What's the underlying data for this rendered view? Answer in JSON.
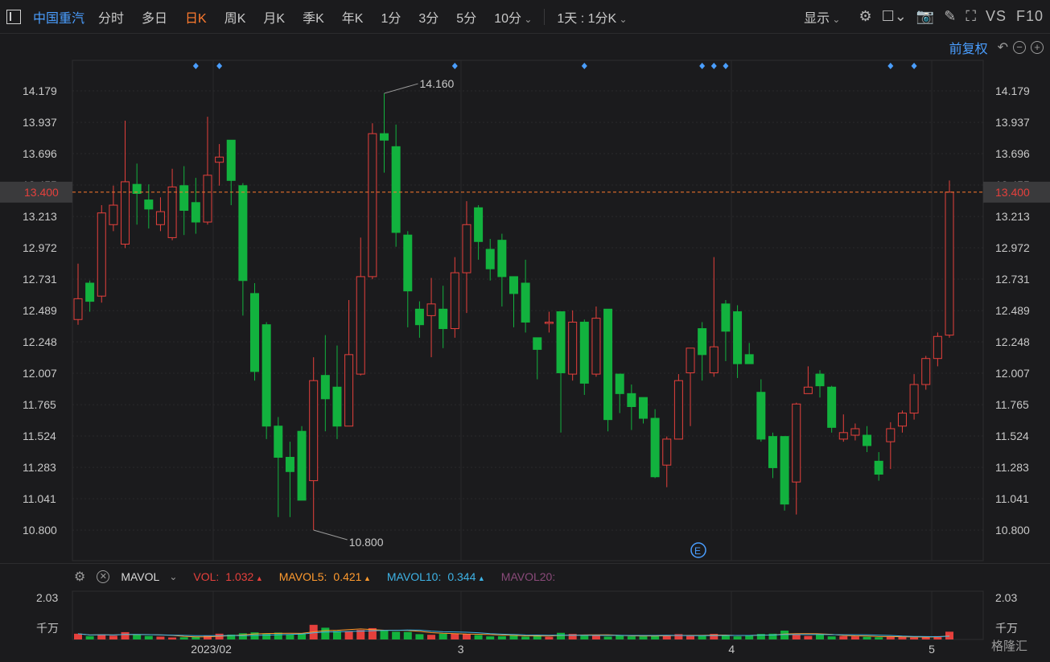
{
  "toolbar": {
    "stock_name": "中国重汽",
    "tabs": [
      {
        "label": "分时",
        "active": false
      },
      {
        "label": "多日",
        "active": false
      },
      {
        "label": "日K",
        "active": true
      },
      {
        "label": "周K",
        "active": false
      },
      {
        "label": "月K",
        "active": false
      },
      {
        "label": "季K",
        "active": false
      },
      {
        "label": "年K",
        "active": false
      },
      {
        "label": "1分",
        "active": false
      },
      {
        "label": "3分",
        "active": false
      },
      {
        "label": "5分",
        "active": false
      },
      {
        "label": "10分",
        "active": false
      }
    ],
    "multi_period": "1天 : 1分K",
    "display": "显示",
    "vs_label": "VS",
    "f10_label": "F10",
    "icons": [
      "gear-icon",
      "square-icon",
      "camera-icon",
      "pencil-icon",
      "fullscreen-icon"
    ]
  },
  "adjust": {
    "label": "前复权"
  },
  "colors": {
    "up": "#e5403c",
    "down": "#12b23e",
    "current_line": "#ff7a2e",
    "accent": "#4a9eff",
    "mavol5": "#ff9a2e",
    "mavol10": "#3eb3e6",
    "mavol20": "#8a4a7a"
  },
  "chart_data": {
    "type": "candlestick",
    "y_ticks": [
      "14.179",
      "13.937",
      "13.696",
      "13.455",
      "13.213",
      "12.972",
      "12.731",
      "12.489",
      "12.248",
      "12.007",
      "11.765",
      "11.524",
      "11.283",
      "11.041",
      "10.800"
    ],
    "ylim": [
      10.8,
      14.179
    ],
    "current_price": "13.400",
    "max_label": "14.160",
    "min_label": "10.800",
    "x_labels": [
      "2023/02",
      "3",
      "4",
      "5"
    ],
    "event_marker": "E",
    "candles": [
      [
        12.42,
        12.58,
        12.85,
        12.38
      ],
      [
        12.7,
        12.56,
        12.72,
        12.48
      ],
      [
        12.6,
        13.24,
        13.3,
        12.55
      ],
      [
        13.15,
        13.3,
        13.45,
        13.1
      ],
      [
        13.0,
        13.48,
        13.95,
        12.97
      ],
      [
        13.46,
        13.39,
        13.62,
        13.15
      ],
      [
        13.34,
        13.27,
        13.46,
        13.12
      ],
      [
        13.15,
        13.25,
        13.36,
        13.1
      ],
      [
        13.05,
        13.44,
        13.58,
        13.03
      ],
      [
        13.45,
        13.26,
        13.6,
        13.07
      ],
      [
        13.32,
        13.17,
        13.51,
        13.08
      ],
      [
        13.17,
        13.53,
        13.98,
        13.15
      ],
      [
        13.63,
        13.67,
        13.77,
        13.45
      ],
      [
        13.8,
        13.49,
        13.8,
        13.3
      ],
      [
        13.45,
        12.72,
        13.47,
        12.45
      ],
      [
        12.62,
        12.02,
        12.7,
        11.95
      ],
      [
        12.38,
        11.6,
        12.4,
        11.5
      ],
      [
        11.6,
        11.36,
        11.67,
        10.9
      ],
      [
        11.36,
        11.25,
        11.48,
        10.9
      ],
      [
        11.56,
        11.03,
        11.6,
        11.03
      ],
      [
        11.18,
        11.95,
        12.13,
        10.8
      ],
      [
        11.99,
        11.81,
        12.3,
        11.56
      ],
      [
        11.9,
        11.6,
        12.22,
        11.5
      ],
      [
        11.6,
        12.15,
        12.57,
        11.6
      ],
      [
        12.0,
        12.75,
        13.05,
        11.99
      ],
      [
        12.75,
        13.85,
        13.93,
        12.73
      ],
      [
        13.85,
        13.8,
        14.16,
        13.55
      ],
      [
        13.75,
        13.09,
        13.92,
        12.98
      ],
      [
        13.07,
        12.64,
        13.1,
        12.36
      ],
      [
        12.5,
        12.38,
        12.56,
        12.28
      ],
      [
        12.45,
        12.54,
        12.74,
        12.13
      ],
      [
        12.5,
        12.35,
        12.68,
        12.2
      ],
      [
        12.35,
        12.78,
        12.9,
        12.28
      ],
      [
        12.78,
        13.15,
        13.33,
        12.47
      ],
      [
        13.28,
        13.02,
        13.3,
        12.88
      ],
      [
        12.96,
        12.81,
        13.04,
        12.72
      ],
      [
        13.03,
        12.75,
        13.08,
        12.52
      ],
      [
        12.75,
        12.62,
        12.75,
        12.36
      ],
      [
        12.7,
        12.4,
        12.88,
        12.32
      ],
      [
        12.28,
        12.19,
        12.28,
        11.96
      ],
      [
        12.39,
        12.4,
        12.48,
        12.32
      ],
      [
        12.48,
        12.01,
        12.48,
        11.55
      ],
      [
        12.0,
        12.4,
        12.49,
        11.95
      ],
      [
        12.4,
        11.93,
        12.42,
        11.84
      ],
      [
        12.0,
        12.43,
        12.52,
        11.98
      ],
      [
        12.5,
        11.65,
        12.5,
        11.56
      ],
      [
        12.0,
        11.85,
        12.0,
        11.7
      ],
      [
        11.85,
        11.75,
        11.92,
        11.57
      ],
      [
        11.82,
        11.66,
        11.82,
        11.62
      ],
      [
        11.66,
        11.21,
        11.73,
        11.2
      ],
      [
        11.3,
        11.5,
        11.52,
        11.13
      ],
      [
        11.5,
        11.95,
        12.0,
        11.5
      ],
      [
        12.01,
        12.2,
        12.2,
        11.6
      ],
      [
        12.35,
        12.15,
        12.4,
        11.95
      ],
      [
        12.01,
        12.21,
        12.9,
        11.98
      ],
      [
        12.54,
        12.33,
        12.57,
        12.1
      ],
      [
        12.48,
        12.08,
        12.53,
        11.97
      ],
      [
        12.15,
        12.08,
        12.24,
        12.08
      ],
      [
        11.86,
        11.5,
        11.96,
        11.48
      ],
      [
        11.52,
        11.28,
        11.55,
        11.2
      ],
      [
        11.52,
        11.0,
        11.52,
        10.95
      ],
      [
        11.17,
        11.77,
        11.78,
        10.92
      ],
      [
        11.85,
        11.9,
        12.06,
        11.85
      ],
      [
        12.0,
        11.91,
        12.03,
        11.82
      ],
      [
        11.9,
        11.59,
        11.91,
        11.55
      ],
      [
        11.5,
        11.55,
        11.69,
        11.48
      ],
      [
        11.53,
        11.58,
        11.62,
        11.49
      ],
      [
        11.53,
        11.45,
        11.6,
        11.4
      ],
      [
        11.33,
        11.23,
        11.4,
        11.18
      ],
      [
        11.48,
        11.58,
        11.63,
        11.27
      ],
      [
        11.6,
        11.7,
        11.72,
        11.55
      ],
      [
        11.7,
        11.92,
        12.0,
        11.65
      ],
      [
        11.92,
        12.12,
        12.14,
        11.88
      ],
      [
        12.12,
        12.29,
        12.32,
        12.06
      ],
      [
        12.3,
        13.4,
        13.49,
        12.28
      ]
    ],
    "volume": {
      "y_top_label": "2.03",
      "unit": "千万",
      "values": [
        0.26,
        0.15,
        0.23,
        0.17,
        0.33,
        0.22,
        0.16,
        0.13,
        0.09,
        0.1,
        0.12,
        0.16,
        0.26,
        0.22,
        0.28,
        0.32,
        0.26,
        0.31,
        0.23,
        0.27,
        0.66,
        0.53,
        0.38,
        0.37,
        0.43,
        0.51,
        0.4,
        0.35,
        0.34,
        0.24,
        0.21,
        0.26,
        0.27,
        0.24,
        0.2,
        0.14,
        0.15,
        0.2,
        0.13,
        0.18,
        0.12,
        0.3,
        0.25,
        0.17,
        0.2,
        0.13,
        0.18,
        0.14,
        0.14,
        0.2,
        0.18,
        0.24,
        0.16,
        0.16,
        0.25,
        0.18,
        0.14,
        0.17,
        0.25,
        0.26,
        0.4,
        0.24,
        0.16,
        0.22,
        0.14,
        0.15,
        0.14,
        0.12,
        0.1,
        0.14,
        0.12,
        0.09,
        0.1,
        0.15,
        0.35
      ]
    }
  },
  "indicator": {
    "name": "MAVOL",
    "items": [
      {
        "label": "VOL:",
        "value": "1.032",
        "color": "#e5403c",
        "arrow": true
      },
      {
        "label": "MAVOL5:",
        "value": "0.421",
        "color": "#ff9a2e",
        "arrow": true
      },
      {
        "label": "MAVOL10:",
        "value": "0.344",
        "color": "#3eb3e6",
        "arrow": true
      },
      {
        "label": "MAVOL20:",
        "value": "",
        "color": "#8a4a7a",
        "arrow": false
      }
    ]
  },
  "watermark": "格隆汇"
}
